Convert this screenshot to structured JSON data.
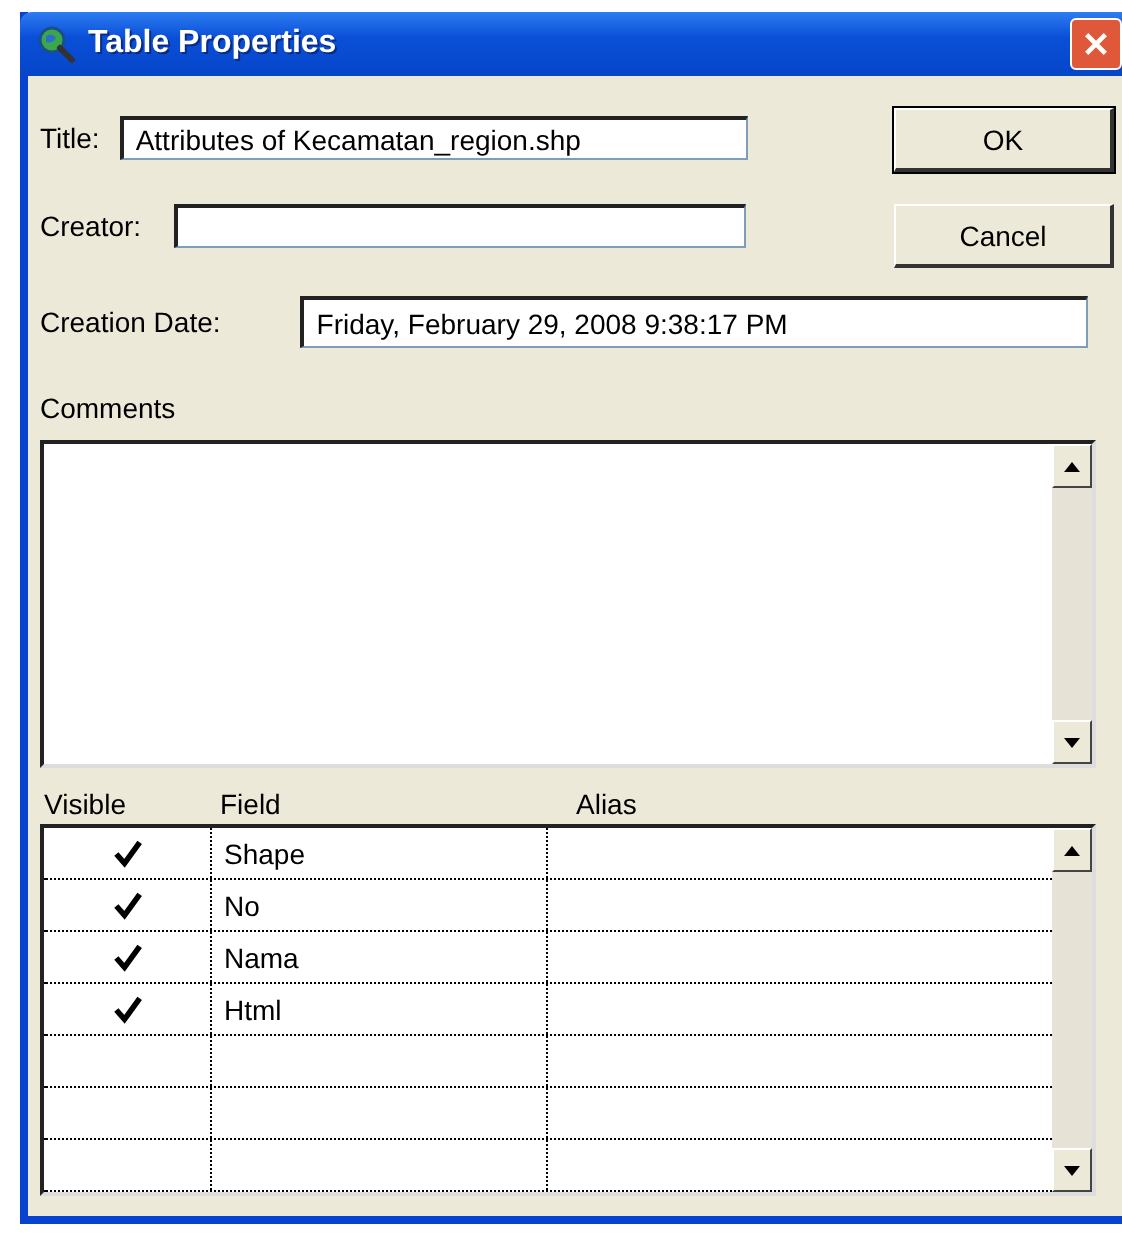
{
  "window": {
    "title": "Table Properties"
  },
  "form": {
    "title_label": "Title:",
    "title_value": "Attributes of Kecamatan_region.shp",
    "creator_label": "Creator:",
    "date_label": "Creation Date:",
    "date_value": "Friday, February 29, 2008 9:38:17 PM",
    "comments_label": "Comments"
  },
  "buttons": [
    "OK",
    "Cancel"
  ],
  "table": {
    "columns": [
      "Visible",
      "Field",
      "Alias"
    ],
    "rows": [
      {
        "visible": true,
        "field": "Shape"
      },
      {
        "visible": true,
        "field": "No"
      },
      {
        "visible": true,
        "field": "Nama"
      },
      {
        "visible": true,
        "field": "Html"
      },
      {
        "visible": false
      },
      {
        "visible": false
      },
      {
        "visible": false
      }
    ]
  }
}
